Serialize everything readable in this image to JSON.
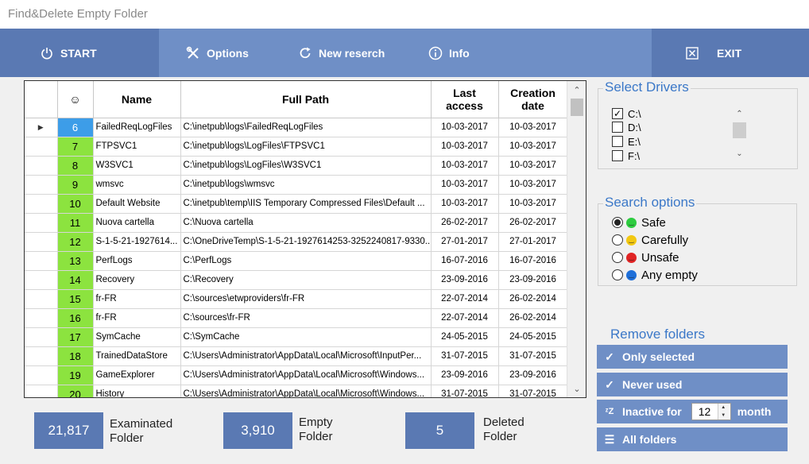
{
  "window": {
    "title": "Find&Delete Empty Folder"
  },
  "toolbar": {
    "start_label": "START",
    "options_label": "Options",
    "new_research_label": "New reserch",
    "info_label": "Info",
    "exit_label": "EXIT"
  },
  "grid": {
    "columns": {
      "icon": "☺",
      "name": "Name",
      "full_path": "Full Path",
      "last_access_1": "Last",
      "last_access_2": "access",
      "creation_1": "Creation",
      "creation_2": "date"
    },
    "rows": [
      {
        "num": "6",
        "name": "FailedReqLogFiles",
        "path": "C:\\inetpub\\logs\\FailedReqLogFiles",
        "last": "10-03-2017",
        "created": "10-03-2017"
      },
      {
        "num": "7",
        "name": "FTPSVC1",
        "path": "C:\\inetpub\\logs\\LogFiles\\FTPSVC1",
        "last": "10-03-2017",
        "created": "10-03-2017"
      },
      {
        "num": "8",
        "name": "W3SVC1",
        "path": "C:\\inetpub\\logs\\LogFiles\\W3SVC1",
        "last": "10-03-2017",
        "created": "10-03-2017"
      },
      {
        "num": "9",
        "name": "wmsvc",
        "path": "C:\\inetpub\\logs\\wmsvc",
        "last": "10-03-2017",
        "created": "10-03-2017"
      },
      {
        "num": "10",
        "name": "Default Website",
        "path": "C:\\inetpub\\temp\\IIS Temporary Compressed Files\\Default ...",
        "last": "10-03-2017",
        "created": "10-03-2017"
      },
      {
        "num": "11",
        "name": "Nuova cartella",
        "path": "C:\\Nuova cartella",
        "last": "26-02-2017",
        "created": "26-02-2017"
      },
      {
        "num": "12",
        "name": "S-1-5-21-1927614...",
        "path": "C:\\OneDriveTemp\\S-1-5-21-1927614253-3252240817-9330...",
        "last": "27-01-2017",
        "created": "27-01-2017"
      },
      {
        "num": "13",
        "name": "PerfLogs",
        "path": "C:\\PerfLogs",
        "last": "16-07-2016",
        "created": "16-07-2016"
      },
      {
        "num": "14",
        "name": "Recovery",
        "path": "C:\\Recovery",
        "last": "23-09-2016",
        "created": "23-09-2016"
      },
      {
        "num": "15",
        "name": "fr-FR",
        "path": "C:\\sources\\etwproviders\\fr-FR",
        "last": "22-07-2014",
        "created": "26-02-2014"
      },
      {
        "num": "16",
        "name": "fr-FR",
        "path": "C:\\sources\\fr-FR",
        "last": "22-07-2014",
        "created": "26-02-2014"
      },
      {
        "num": "17",
        "name": "SymCache",
        "path": "C:\\SymCache",
        "last": "24-05-2015",
        "created": "24-05-2015"
      },
      {
        "num": "18",
        "name": "TrainedDataStore",
        "path": "C:\\Users\\Administrator\\AppData\\Local\\Microsoft\\InputPer...",
        "last": "31-07-2015",
        "created": "31-07-2015"
      },
      {
        "num": "19",
        "name": "GameExplorer",
        "path": "C:\\Users\\Administrator\\AppData\\Local\\Microsoft\\Windows...",
        "last": "23-09-2016",
        "created": "23-09-2016"
      },
      {
        "num": "20",
        "name": "History",
        "path": "C:\\Users\\Administrator\\AppData\\Local\\Microsoft\\Windows...",
        "last": "31-07-2015",
        "created": "31-07-2015"
      }
    ]
  },
  "drivers": {
    "title": "Select Drivers",
    "items": [
      {
        "label": "C:\\",
        "checked": true
      },
      {
        "label": "D:\\",
        "checked": false
      },
      {
        "label": "E:\\",
        "checked": false
      },
      {
        "label": "F:\\",
        "checked": false
      }
    ]
  },
  "search_options": {
    "title": "Search options",
    "items": [
      {
        "label": "Safe",
        "selected": true,
        "color": "#2ecc40"
      },
      {
        "label": "Carefully",
        "selected": false,
        "color": "#f2c811"
      },
      {
        "label": "Unsafe",
        "selected": false,
        "color": "#e02424"
      },
      {
        "label": "Any empty",
        "selected": false,
        "color": "#1e6fd9"
      }
    ]
  },
  "remove": {
    "title": "Remove folders",
    "only_selected": "Only selected",
    "never_used": "Never used",
    "inactive_for": "Inactive for",
    "months_value": "12",
    "month_label": "month",
    "all_folders": "All folders"
  },
  "stats": {
    "examined_value": "21,817",
    "examined_l1": "Examinated",
    "examined_l2": "Folder",
    "empty_value": "3,910",
    "empty_l1": "Empty",
    "empty_l2": "Folder",
    "deleted_value": "5",
    "deleted_l1": "Deleted",
    "deleted_l2": "Folder"
  },
  "colors": {
    "toolbar": "#6f8fc6",
    "toolbar_dark": "#5a79b3",
    "accent_title": "#3b78c8",
    "row_green": "#8ce33f",
    "row_selected": "#3d9de8"
  }
}
